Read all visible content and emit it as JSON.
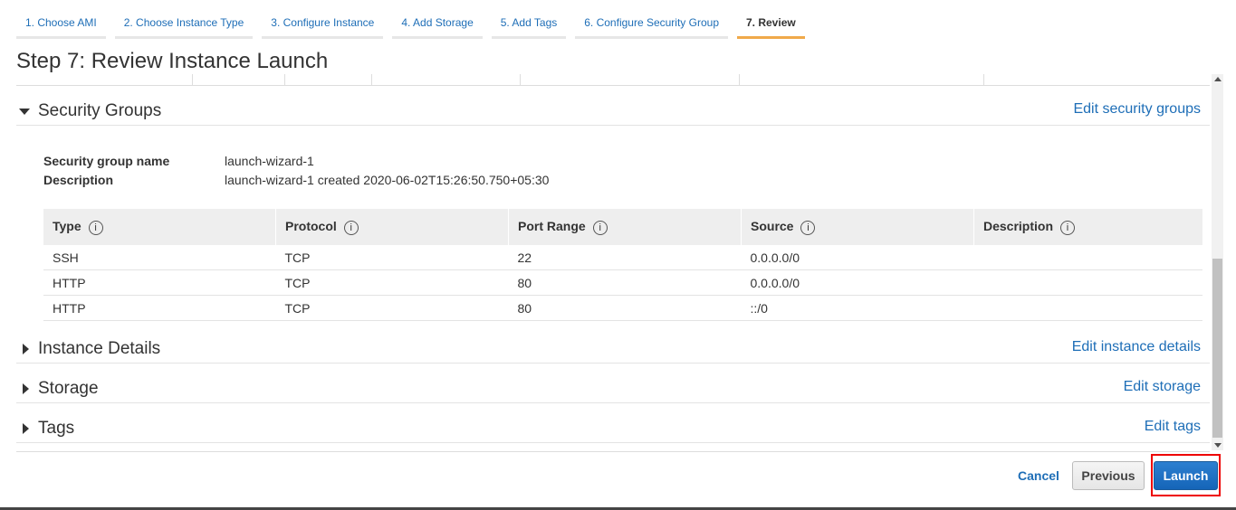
{
  "wizard_tabs": [
    {
      "label": "1. Choose AMI"
    },
    {
      "label": "2. Choose Instance Type"
    },
    {
      "label": "3. Configure Instance"
    },
    {
      "label": "4. Add Storage"
    },
    {
      "label": "5. Add Tags"
    },
    {
      "label": "6. Configure Security Group"
    },
    {
      "label": "7. Review"
    }
  ],
  "page_title": "Step 7: Review Instance Launch",
  "security_groups": {
    "title": "Security Groups",
    "edit_label": "Edit security groups",
    "name_label": "Security group name",
    "name_value": "launch-wizard-1",
    "description_label": "Description",
    "description_value": "launch-wizard-1 created 2020-06-02T15:26:50.750+05:30",
    "columns": [
      "Type",
      "Protocol",
      "Port Range",
      "Source",
      "Description"
    ],
    "info_icon": "i",
    "rows": [
      {
        "type": "SSH",
        "protocol": "TCP",
        "port_range": "22",
        "source": "0.0.0.0/0",
        "description": ""
      },
      {
        "type": "HTTP",
        "protocol": "TCP",
        "port_range": "80",
        "source": "0.0.0.0/0",
        "description": ""
      },
      {
        "type": "HTTP",
        "protocol": "TCP",
        "port_range": "80",
        "source": "::/0",
        "description": ""
      }
    ]
  },
  "instance_details": {
    "title": "Instance Details",
    "edit_label": "Edit instance details"
  },
  "storage": {
    "title": "Storage",
    "edit_label": "Edit storage"
  },
  "tags": {
    "title": "Tags",
    "edit_label": "Edit tags"
  },
  "footer": {
    "cancel_label": "Cancel",
    "previous_label": "Previous",
    "launch_label": "Launch"
  },
  "colors": {
    "link": "#1e6eb7",
    "active_tab_underline": "#f0a94a",
    "launch_button": "#1565b8",
    "highlight": "#ee0000"
  }
}
